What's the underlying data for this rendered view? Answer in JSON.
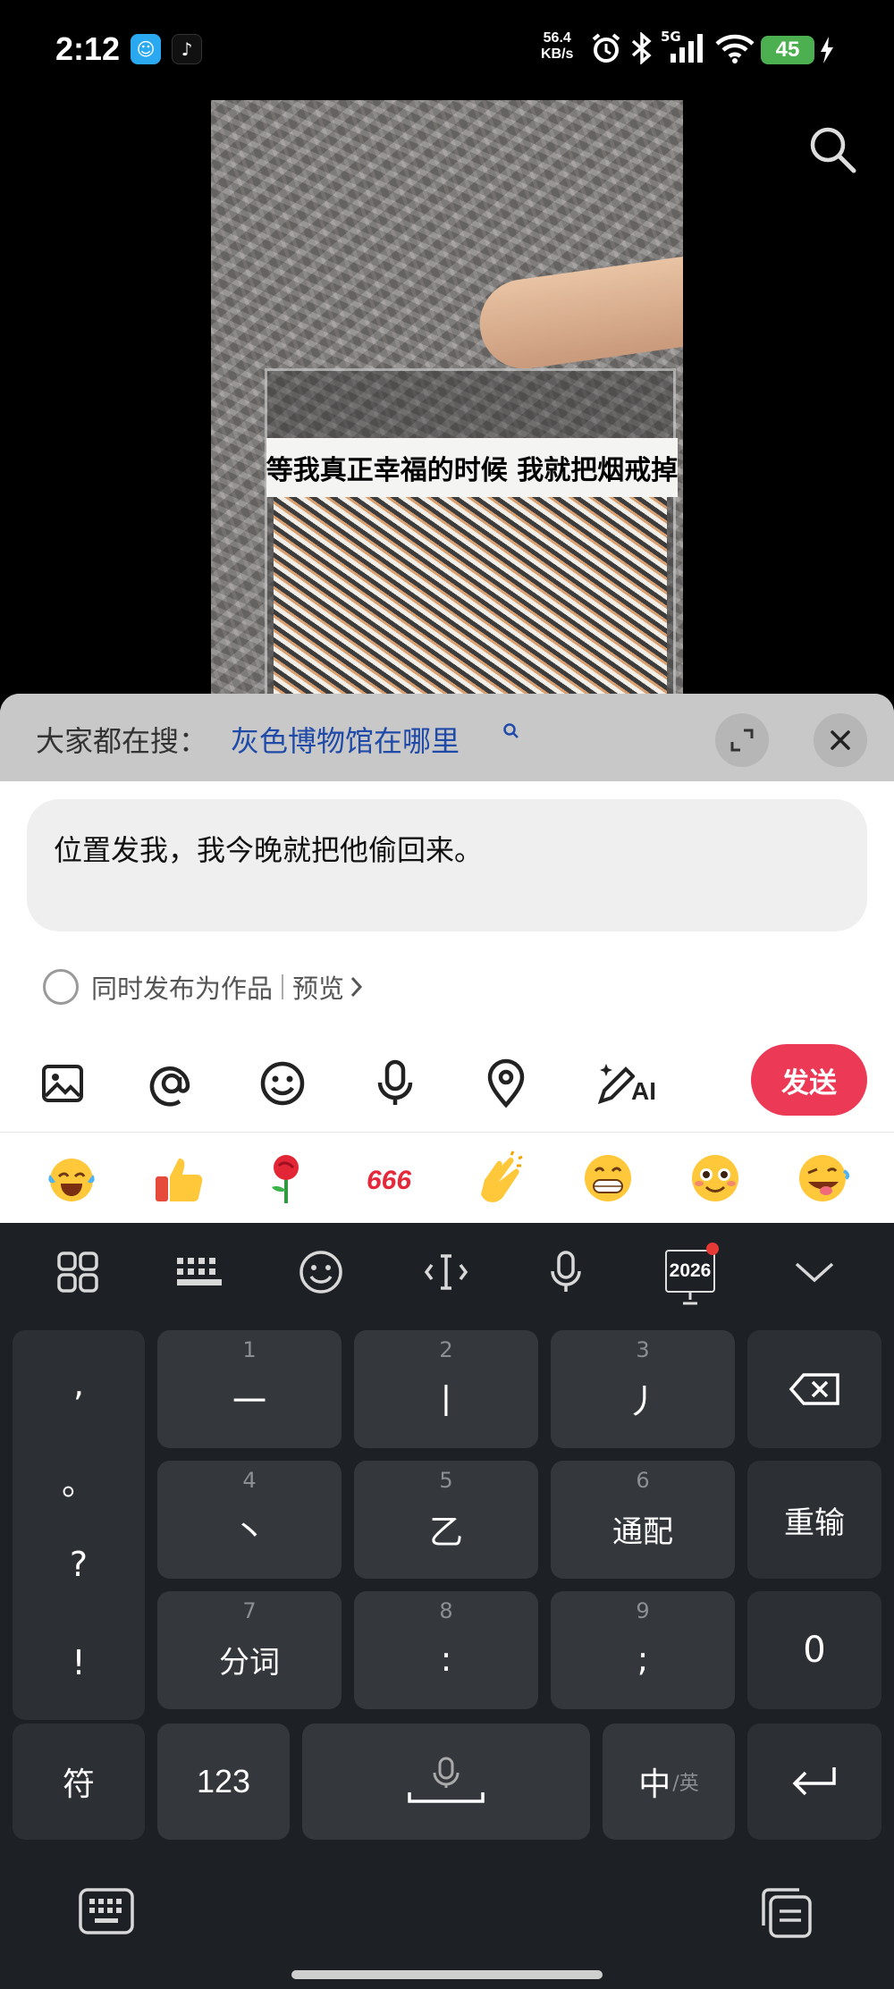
{
  "status_bar": {
    "time": "2:12",
    "net_speed_value": "56.4",
    "net_speed_unit": "KB/s",
    "network_type": "5G",
    "battery": "45"
  },
  "video": {
    "caption": "等我真正幸福的时候 我就把烟戒掉"
  },
  "comment_sheet": {
    "hot_search_prefix": "大家都在搜：",
    "hot_search_query": "灰色博物馆在哪里",
    "input_text": "位置发我，我今晚就把他偷回来。",
    "publish_label": "同时发布为作品",
    "preview_label": "预览",
    "send_label": "发送",
    "ai_label": "AI",
    "emojis": [
      "laughing-crying",
      "thumbs-up",
      "rose",
      "666",
      "clapping",
      "grinning",
      "smiling-blush",
      "winking-tongue"
    ]
  },
  "keyboard": {
    "year_badge": "2026",
    "punctuation": [
      ",",
      "。",
      "?",
      "!"
    ],
    "row1": [
      {
        "num": "1",
        "label": "一"
      },
      {
        "num": "2",
        "label": "丨"
      },
      {
        "num": "3",
        "label": "丿"
      }
    ],
    "row2": [
      {
        "num": "4",
        "label": "丶"
      },
      {
        "num": "5",
        "label": "乙"
      },
      {
        "num": "6",
        "label": "通配"
      }
    ],
    "row3": [
      {
        "num": "7",
        "label": "分词"
      },
      {
        "num": "8",
        "label": ":"
      },
      {
        "num": "9",
        "label": ";"
      }
    ],
    "reinput": "重输",
    "zero": "0",
    "symbols": "符",
    "numbers": "123",
    "lang_main": "中",
    "lang_sub": "/英"
  }
}
